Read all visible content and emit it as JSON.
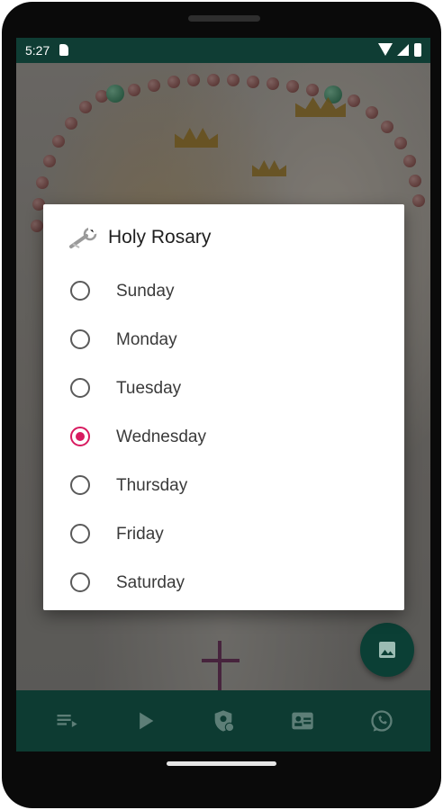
{
  "status_bar": {
    "time": "5:27",
    "icons": [
      "sd-card-icon",
      "wifi-icon",
      "signal-icon",
      "battery-icon"
    ]
  },
  "dialog": {
    "title": "Holy Rosary",
    "icon": "wrench-icon",
    "options": [
      {
        "label": "Sunday",
        "selected": false
      },
      {
        "label": "Monday",
        "selected": false
      },
      {
        "label": "Tuesday",
        "selected": false
      },
      {
        "label": "Wednesday",
        "selected": true
      },
      {
        "label": "Thursday",
        "selected": false
      },
      {
        "label": "Friday",
        "selected": false
      },
      {
        "label": "Saturday",
        "selected": false
      }
    ],
    "accent_color": "#d81b60"
  },
  "fab": {
    "icon": "image-icon"
  },
  "bottom_nav": {
    "items": [
      {
        "icon": "playlist-icon"
      },
      {
        "icon": "play-icon"
      },
      {
        "icon": "verified-user-icon"
      },
      {
        "icon": "contact-card-icon"
      },
      {
        "icon": "whatsapp-icon"
      }
    ]
  },
  "colors": {
    "brand_dark_green": "#0d3b32",
    "accent": "#d81b60"
  }
}
